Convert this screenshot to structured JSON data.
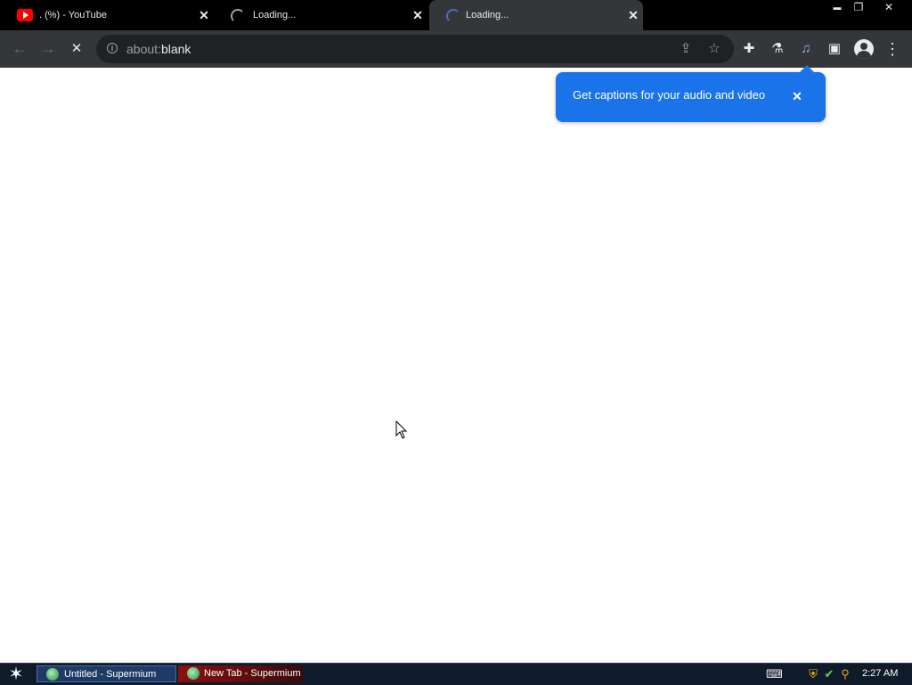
{
  "tabs": [
    {
      "title": ". (%) - YouTube",
      "close": "✕",
      "favicon": "youtube-icon"
    },
    {
      "title": "Loading...",
      "close": "✕",
      "favicon": "loading-spinner-icon"
    },
    {
      "title": "Loading...",
      "close": "✕",
      "favicon": "loading-spinner-icon"
    }
  ],
  "window_controls": {
    "minimize": "▬",
    "restore": "❐",
    "close": "✕"
  },
  "toolbar": {
    "back": "←",
    "forward": "→",
    "stop": "✕",
    "url_scheme": "about:",
    "url_host": "blank",
    "info_icon": "i",
    "share_icon": "⇪",
    "bookmark_icon": "☆",
    "extensions_icon": "✚",
    "labs_icon": "⚗",
    "media_icon": "♫",
    "side_panel_icon": "▣",
    "menu_icon": "⋮"
  },
  "caption_bubble": {
    "text": "Get captions for your audio and video",
    "close": "✕",
    "color": "#1a73e8"
  },
  "taskbar": {
    "start_icon": "✶",
    "items": [
      {
        "label": "Untitled - Supermium"
      },
      {
        "label": "New Tab - Supermium"
      }
    ],
    "tray": {
      "keyboard": "⌨",
      "shield": "⛨",
      "network": "✔",
      "search": "⚲"
    },
    "clock": "2:27 AM"
  },
  "colors": {
    "tab_strip": "#000000",
    "toolbar": "#35363a",
    "omnibox": "#202124",
    "taskbar": "#0f1a2a",
    "accent": "#1a73e8"
  }
}
